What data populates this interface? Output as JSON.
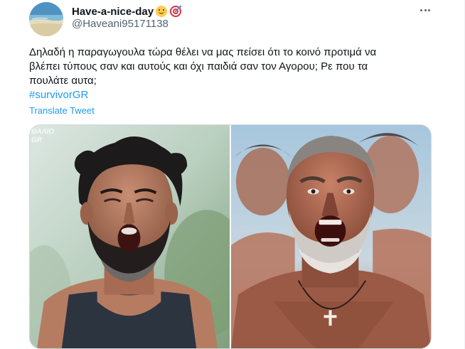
{
  "tweet": {
    "display_name": "Have-a-nice-day",
    "name_emojis": [
      "smiling-face-icon",
      "bullseye-icon"
    ],
    "handle": "@Haveani95171138",
    "text": "Δηλαδή η παραγωγουλα τώρα θέλει να μας πείσει ότι το κοινό προτιμά να\nβλέπει τύπους σαν και αυτούς και όχι παιδιά σαν τον Αγορου; Ρε που τα\nπουλάτε αυτα;",
    "hashtag": "#survivorGR",
    "translate_label": "Translate Tweet",
    "more_icon": "more-horizontal-icon"
  },
  "media": {
    "left_watermark": "ΘΑΛΙΟ\nGR",
    "left_alt": "photo-bearded-man-shouting",
    "right_alt": "photo-grey-bearded-man-roaring"
  },
  "colors": {
    "link": "#1d9bf0",
    "text": "#0f1419",
    "secondary": "#536471",
    "border": "#cfd9de"
  }
}
